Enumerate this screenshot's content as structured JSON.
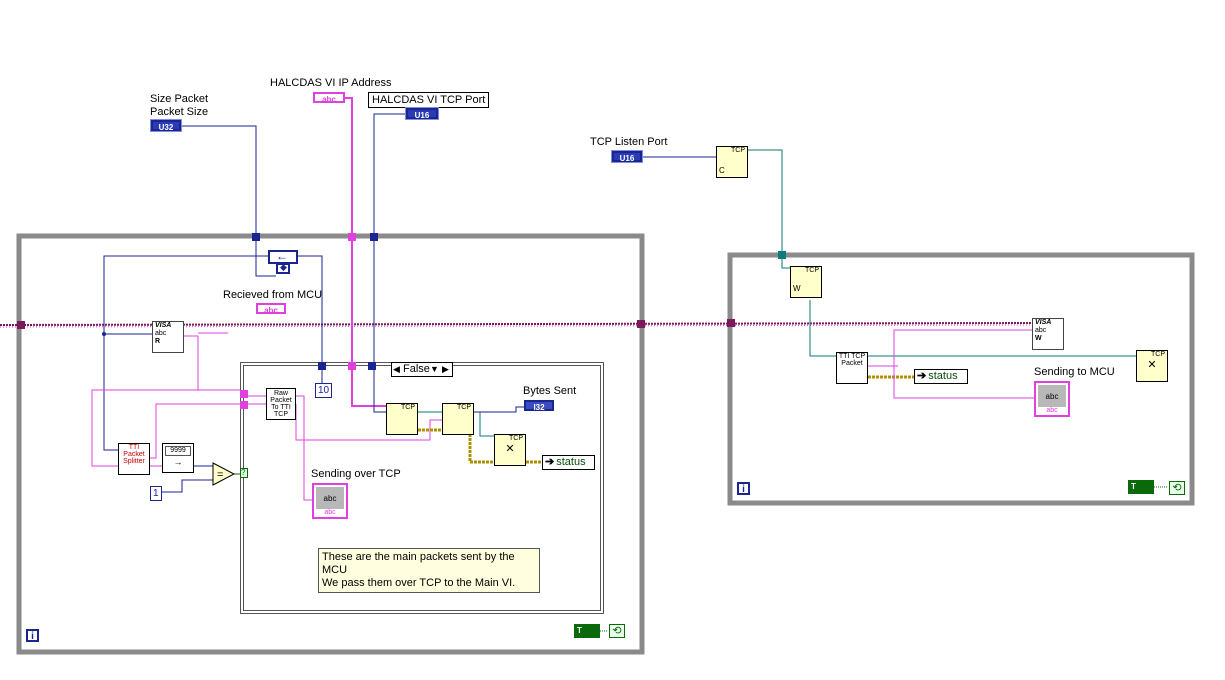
{
  "labels": {
    "size_packet": "Size Packet",
    "packet_size": "Packet Size",
    "halcdas_ip": "HALCDAS VI IP Address",
    "halcdas_port": "HALCDAS VI TCP Port",
    "tcp_listen_port": "TCP Listen Port",
    "received_from_mcu": "Recieved from MCU",
    "bytes_sent": "Bytes Sent",
    "sending_over_tcp": "Sending over TCP",
    "sending_to_mcu": "Sending to MCU"
  },
  "terminals": {
    "packet_size_type": "U32",
    "ip_type": "abc",
    "port_type": "U16",
    "listen_port_type": "U16",
    "received_type": "abc",
    "bytes_sent_type": "I32",
    "sending_over_tcp_type": "abc",
    "sending_to_mcu_type": "abc"
  },
  "case_structure": {
    "selector": "False"
  },
  "constants": {
    "ten": "10",
    "one": "1"
  },
  "indicators": {
    "status_left": "status",
    "status_right": "status"
  },
  "nodes": {
    "tcp_listen": "TCP",
    "tcp_listen_sub": "C",
    "tcp_wait": "TCP",
    "tcp_wait_sub": "W",
    "visa_read": "VISA",
    "visa_read_sub": "R",
    "visa_write": "VISA",
    "visa_write_sub": "W",
    "raw_packet": "Raw Packet To TTI TCP",
    "tti_splitter": "TTI Packet Splitter",
    "tti_tcp_packet": "TTI TCP Packet",
    "tcp_open": "TCP",
    "tcp_write": "TCP",
    "tcp_close": "TCP",
    "tcp_close_right": "TCP",
    "format_const": "9999",
    "equals": "="
  },
  "comment": {
    "line1": "These are the main packets sent by the MCU",
    "line2": "We pass them over TCP to the Main VI."
  },
  "loops": {
    "iteration_symbol": "i",
    "stop_true": "T",
    "stop_symbol": "⟲"
  },
  "colors": {
    "string_wire": "#e040e0",
    "numeric_wire": "#1a2590",
    "refnum_wire": "#0a7a7a",
    "error_wire": "#b09000",
    "visa_wire": "#7a1a5a",
    "boolean_wire": "#0a6a0a",
    "loop_frame": "#888888"
  }
}
